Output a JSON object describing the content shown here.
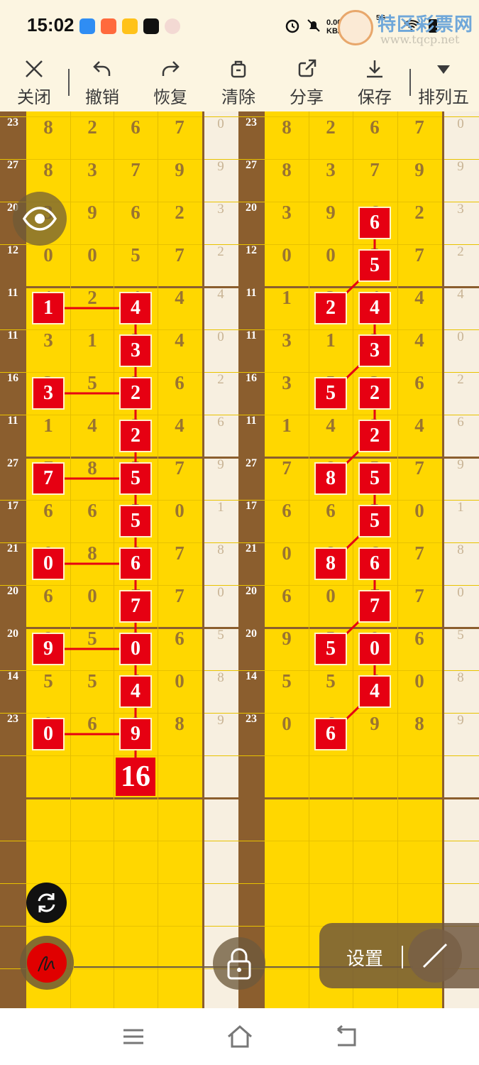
{
  "status_bar": {
    "time": "15:02",
    "net_speed_top": "0.00",
    "net_speed_unit": "KB/s",
    "signal_label": "5G",
    "app_icons": [
      "cloud-app-icon",
      "video-app-icon",
      "yellow-app-icon",
      "tiktok-icon",
      "avatar-app-icon"
    ],
    "status_icons": [
      "alarm-icon",
      "bell-off-icon",
      "signal-5g-icon",
      "signal-5g-icon",
      "wifi-icon",
      "battery-icon"
    ]
  },
  "watermark": {
    "title": "特区彩票网",
    "url": "www.tqcp.net"
  },
  "toolbar": {
    "items": [
      {
        "label": "关闭",
        "icon": "close-icon"
      },
      {
        "label": "撤销",
        "icon": "undo-icon"
      },
      {
        "label": "恢复",
        "icon": "redo-icon"
      },
      {
        "label": "清除",
        "icon": "trash-icon"
      },
      {
        "label": "分享",
        "icon": "share-icon"
      },
      {
        "label": "保存",
        "icon": "download-icon"
      },
      {
        "label": "排列五",
        "icon": "caret-down-icon"
      }
    ]
  },
  "colors": {
    "board_yellow": "#FFD700",
    "index_brown": "#8B5E2E",
    "highlight_red": "#E60012",
    "remainder_cream": "#F7EFE0"
  },
  "board": {
    "rows": [
      {
        "idx": "23",
        "d": [
          "8",
          "2",
          "6",
          "7"
        ],
        "rem": "0"
      },
      {
        "idx": "27",
        "d": [
          "8",
          "3",
          "7",
          "9"
        ],
        "rem": "9"
      },
      {
        "idx": "20",
        "d": [
          "3",
          "9",
          "6",
          "2"
        ],
        "rem": "3"
      },
      {
        "idx": "12",
        "d": [
          "0",
          "0",
          "5",
          "7"
        ],
        "rem": "2"
      },
      {
        "idx": "11",
        "d": [
          "1",
          "2",
          "4",
          "4"
        ],
        "rem": "4"
      },
      {
        "idx": "11",
        "d": [
          "3",
          "1",
          "3",
          "4"
        ],
        "rem": "0"
      },
      {
        "idx": "16",
        "d": [
          "3",
          "5",
          "2",
          "6"
        ],
        "rem": "2"
      },
      {
        "idx": "11",
        "d": [
          "1",
          "4",
          "2",
          "4"
        ],
        "rem": "6"
      },
      {
        "idx": "27",
        "d": [
          "7",
          "8",
          "5",
          "7"
        ],
        "rem": "9"
      },
      {
        "idx": "17",
        "d": [
          "6",
          "6",
          "5",
          "0"
        ],
        "rem": "1"
      },
      {
        "idx": "21",
        "d": [
          "0",
          "8",
          "6",
          "7"
        ],
        "rem": "8"
      },
      {
        "idx": "20",
        "d": [
          "6",
          "0",
          "7",
          "7"
        ],
        "rem": "0"
      },
      {
        "idx": "20",
        "d": [
          "9",
          "5",
          "0",
          "6"
        ],
        "rem": "5"
      },
      {
        "idx": "14",
        "d": [
          "5",
          "5",
          "4",
          "0"
        ],
        "rem": "8"
      },
      {
        "idx": "23",
        "d": [
          "0",
          "6",
          "9",
          "8"
        ],
        "rem": "9"
      }
    ],
    "left_highlights": [
      [
        4,
        0
      ],
      [
        4,
        2
      ],
      [
        5,
        2
      ],
      [
        6,
        0
      ],
      [
        6,
        2
      ],
      [
        7,
        2
      ],
      [
        8,
        0
      ],
      [
        8,
        2
      ],
      [
        9,
        2
      ],
      [
        10,
        0
      ],
      [
        10,
        2
      ],
      [
        11,
        2
      ],
      [
        12,
        0
      ],
      [
        12,
        2
      ],
      [
        13,
        2
      ],
      [
        14,
        0
      ],
      [
        14,
        2
      ]
    ],
    "left_links": [
      [
        4,
        0,
        4,
        2
      ],
      [
        6,
        0,
        6,
        2
      ],
      [
        8,
        0,
        8,
        2
      ],
      [
        10,
        0,
        10,
        2
      ],
      [
        12,
        0,
        12,
        2
      ],
      [
        14,
        0,
        14,
        2
      ],
      [
        4,
        2,
        5,
        2
      ],
      [
        5,
        2,
        6,
        2
      ],
      [
        6,
        2,
        7,
        2
      ],
      [
        7,
        2,
        8,
        2
      ],
      [
        8,
        2,
        9,
        2
      ],
      [
        9,
        2,
        10,
        2
      ],
      [
        10,
        2,
        11,
        2
      ],
      [
        11,
        2,
        12,
        2
      ],
      [
        12,
        2,
        13,
        2
      ],
      [
        13,
        2,
        14,
        2
      ]
    ],
    "left_sum": "16",
    "right_highlights": [
      [
        2,
        2
      ],
      [
        3,
        2
      ],
      [
        4,
        1
      ],
      [
        4,
        2
      ],
      [
        5,
        2
      ],
      [
        6,
        1
      ],
      [
        6,
        2
      ],
      [
        7,
        2
      ],
      [
        8,
        1
      ],
      [
        8,
        2
      ],
      [
        9,
        2
      ],
      [
        10,
        1
      ],
      [
        10,
        2
      ],
      [
        11,
        2
      ],
      [
        12,
        1
      ],
      [
        12,
        2
      ],
      [
        13,
        2
      ],
      [
        14,
        1
      ]
    ],
    "right_links": [
      [
        2,
        2,
        3,
        2
      ],
      [
        3,
        2,
        4,
        1
      ],
      [
        4,
        2,
        5,
        2
      ],
      [
        5,
        2,
        6,
        1
      ],
      [
        6,
        2,
        7,
        2
      ],
      [
        7,
        2,
        8,
        1
      ],
      [
        8,
        2,
        9,
        2
      ],
      [
        9,
        2,
        10,
        1
      ],
      [
        10,
        2,
        11,
        2
      ],
      [
        11,
        2,
        12,
        1
      ],
      [
        12,
        2,
        13,
        2
      ],
      [
        13,
        2,
        14,
        1
      ]
    ]
  },
  "floating": {
    "settings_label": "设置",
    "eye_icon": "eye-icon",
    "refresh_icon": "refresh-icon",
    "pen_icon": "pen-icon",
    "lock_icon": "lock-icon",
    "line_icon": "line-tool-icon"
  },
  "navbar": {
    "icons": [
      "menu-icon",
      "home-icon",
      "back-icon"
    ]
  }
}
